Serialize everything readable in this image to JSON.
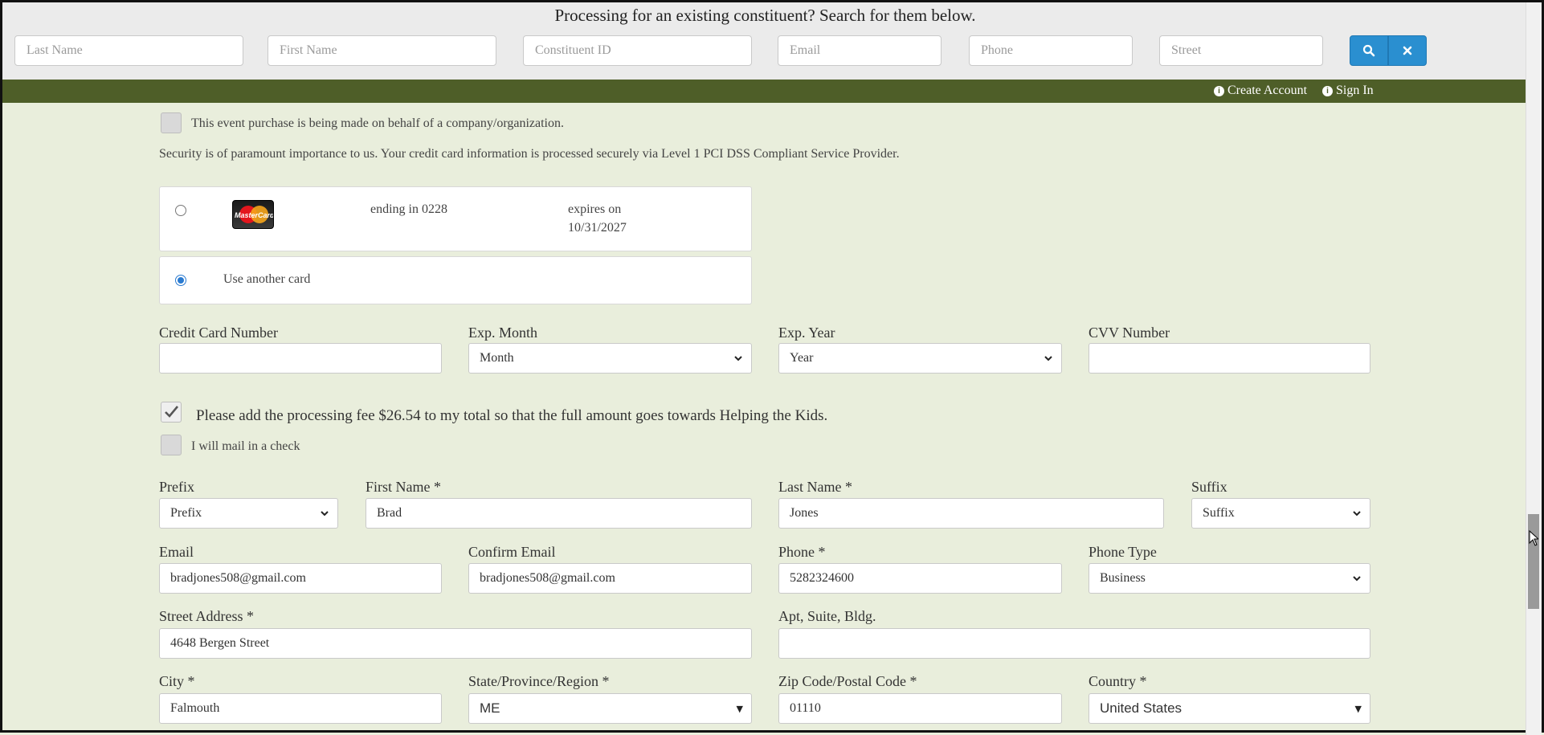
{
  "search": {
    "title": "Processing for an existing constituent? Search for them below.",
    "fields": [
      "Last Name",
      "First Name",
      "Constituent ID",
      "Email",
      "Phone",
      "Street"
    ]
  },
  "account": {
    "create": "Create Account",
    "signin": "Sign In"
  },
  "org_checkbox_label": "This event purchase is being made on behalf of a company/organization.",
  "security_text": "Security is of paramount importance to us. Your credit card information is processed securely via Level 1 PCI DSS Compliant Service Provider.",
  "saved_card": {
    "logo_text": "MasterCard",
    "ending": "ending in 0228",
    "expires_label": "expires on",
    "expires_date": "10/31/2027"
  },
  "another_card_label": "Use another card",
  "payment": {
    "cc_label": "Credit Card Number",
    "month_label": "Exp. Month",
    "month_value": "Month",
    "year_label": "Exp. Year",
    "year_value": "Year",
    "cvv_label": "CVV Number"
  },
  "fee_label": "Please add the processing fee $26.54 to my total so that the full amount goes towards Helping the Kids.",
  "check_label": "I will mail in a check",
  "contact": {
    "prefix_label": "Prefix",
    "prefix_value": "Prefix",
    "first_label": "First Name *",
    "first_value": "Brad",
    "last_label": "Last Name *",
    "last_value": "Jones",
    "suffix_label": "Suffix",
    "suffix_value": "Suffix",
    "email_label": "Email",
    "email_value": "bradjones508@gmail.com",
    "confirm_label": "Confirm Email",
    "confirm_value": "bradjones508@gmail.com",
    "phone_label": "Phone *",
    "phone_value": "5282324600",
    "phonetype_label": "Phone Type",
    "phonetype_value": "Business",
    "street_label": "Street Address *",
    "street_value": "4648 Bergen Street",
    "apt_label": "Apt, Suite, Bldg.",
    "apt_value": "",
    "city_label": "City *",
    "city_value": "Falmouth",
    "state_label": "State/Province/Region *",
    "state_value": "ME",
    "zip_label": "Zip Code/Postal Code *",
    "zip_value": "01110",
    "country_label": "Country *",
    "country_value": "United States"
  },
  "colors": {
    "header_green": "#4e5e28",
    "page_bg": "#e9eedc",
    "button_blue": "#2a8fd0"
  }
}
